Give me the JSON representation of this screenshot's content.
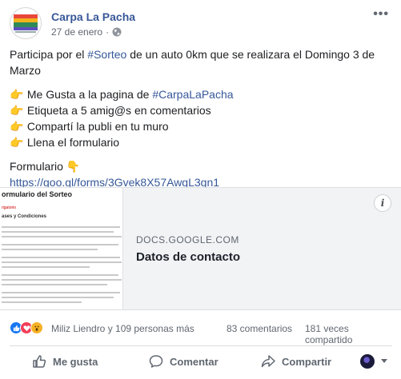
{
  "post": {
    "page_name": "Carpa La Pacha",
    "date": "27 de enero",
    "meta_sep": "·",
    "avatar_logo_text": "Carpa La Pacha",
    "more_label": "•••"
  },
  "body": {
    "intro_before": "Participa por el ",
    "intro_hashtag": "#Sorteo",
    "intro_after": " de un auto 0km que se realizara el Domingo 3 de Marzo",
    "steps": [
      {
        "emoji": "👉",
        "before": " Me Gusta a la pagina de ",
        "hashtag": "#CarpaLaPacha",
        "after": ""
      },
      {
        "emoji": "👉",
        "before": " Etiqueta a 5 amig@s en comentarios",
        "hashtag": "",
        "after": ""
      },
      {
        "emoji": "👉",
        "before": " Compartí la publi en tu muro",
        "hashtag": "",
        "after": ""
      },
      {
        "emoji": "👉",
        "before": " Llena el formulario",
        "hashtag": "",
        "after": ""
      }
    ],
    "form_label": "Formulario ",
    "form_emoji": "👇",
    "link": "https://goo.gl/forms/3Gvek8X57AwgL3gn1"
  },
  "card": {
    "thumb_title": "ormulario del Sorteo",
    "thumb_sub1": "rigatorio",
    "thumb_sub2": "ases y Condiciones",
    "domain": "DOCS.GOOGLE.COM",
    "title": "Datos de contacto",
    "info_label": "i"
  },
  "reactions": {
    "text": "Miliz Liendro y 109 personas más",
    "comments": "83 comentarios",
    "shares": "181 veces compartido",
    "colors": {
      "like": "#1877f2",
      "love": "#f33e58",
      "wow": "#f7b125"
    }
  },
  "actions": {
    "like": "Me gusta",
    "comment": "Comentar",
    "share": "Compartir"
  }
}
